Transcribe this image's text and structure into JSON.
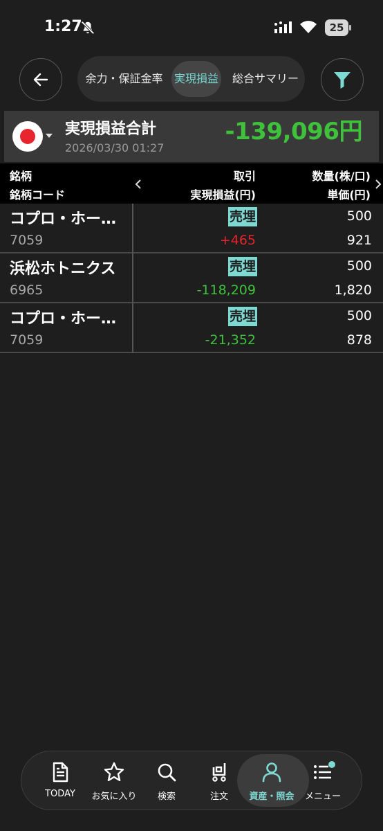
{
  "status_bar": {
    "time": "1:27",
    "battery": "25"
  },
  "nav": {
    "tabs": [
      {
        "label": "余力・保証金率",
        "active": false
      },
      {
        "label": "実現損益",
        "active": true
      },
      {
        "label": "総合サマリー",
        "active": false
      }
    ]
  },
  "summary": {
    "title": "実現損益合計",
    "date": "2026/03/30 01:27",
    "total": "-139,096円"
  },
  "table": {
    "headers": {
      "name": "銘柄",
      "code": "銘柄コード",
      "trade": "取引",
      "pl": "実現損益(円)",
      "qty": "数量(株/口)",
      "price": "単価(円)"
    },
    "rows": [
      {
        "name": "コプロ・ホー…",
        "code": "7059",
        "trade": "売埋",
        "pl": "+465",
        "qty": "500",
        "price": "921"
      },
      {
        "name": "浜松ホトニクス",
        "code": "6965",
        "trade": "売埋",
        "pl": "-118,209",
        "qty": "500",
        "price": "1,820"
      },
      {
        "name": "コプロ・ホー…",
        "code": "7059",
        "trade": "売埋",
        "pl": "-21,352",
        "qty": "500",
        "price": "878"
      }
    ]
  },
  "bottom_nav": {
    "items": [
      {
        "label": "TODAY",
        "icon": "document-icon"
      },
      {
        "label": "お気に入り",
        "icon": "star-icon"
      },
      {
        "label": "検索",
        "icon": "search-icon"
      },
      {
        "label": "注文",
        "icon": "cart-icon"
      },
      {
        "label": "資産・照会",
        "icon": "person-icon",
        "active": true
      },
      {
        "label": "メニュー",
        "icon": "menu-icon"
      }
    ]
  },
  "colors": {
    "positive": "#e4252c",
    "negative": "#3fc13c",
    "accent": "#7fd9d3",
    "background": "#1e1e1e"
  }
}
